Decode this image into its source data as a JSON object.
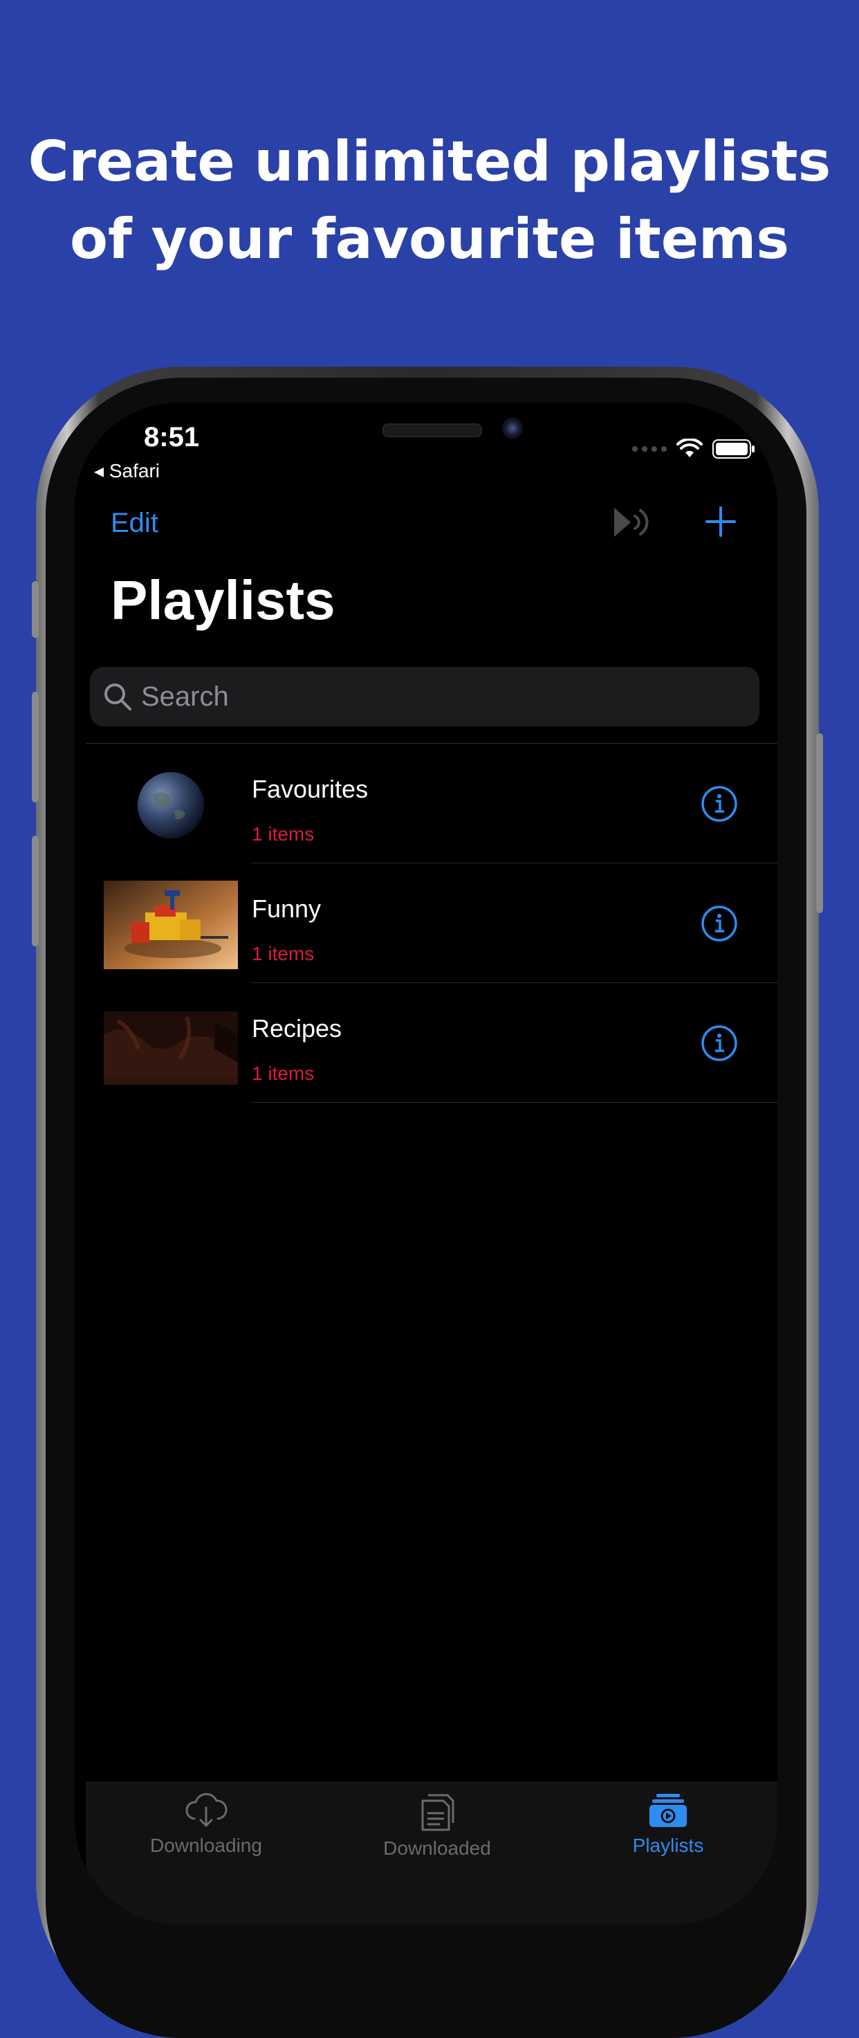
{
  "headline": {
    "line1": "Create unlimited playlists",
    "line2": "of your favourite items"
  },
  "status_bar": {
    "time": "8:51",
    "back_app": "Safari"
  },
  "nav": {
    "edit_label": "Edit",
    "title": "Playlists"
  },
  "search": {
    "placeholder": "Search"
  },
  "playlists": [
    {
      "title": "Favourites",
      "count": "1 items"
    },
    {
      "title": "Funny",
      "count": "1 items"
    },
    {
      "title": "Recipes",
      "count": "1 items"
    }
  ],
  "tabs": [
    {
      "label": "Downloading",
      "icon": "cloud-download-icon"
    },
    {
      "label": "Downloaded",
      "icon": "files-icon"
    },
    {
      "label": "Playlists",
      "icon": "playlists-icon"
    }
  ],
  "colors": {
    "background": "#2a41a8",
    "accent": "#2d8cf0",
    "subtitle_red": "#d81c3f",
    "tab_inactive": "#6b6b6b"
  }
}
